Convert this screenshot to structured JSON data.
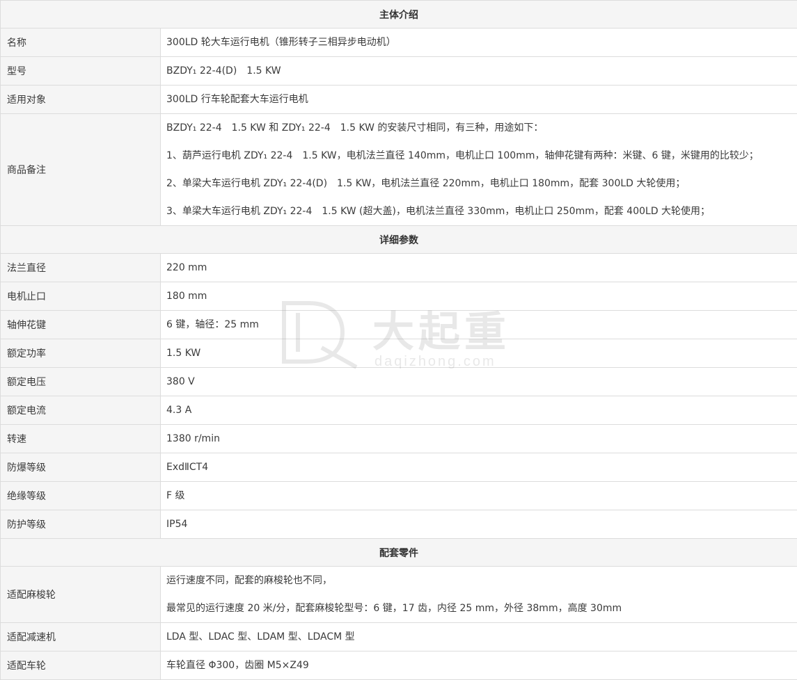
{
  "sections": [
    {
      "title": "主体介绍",
      "rows": [
        {
          "label": "名称",
          "lines": [
            "300LD 轮大车运行电机（锥形转子三相异步电动机）"
          ]
        },
        {
          "label": "型号",
          "lines": [
            "BZDY₁ 22-4(D)　1.5 KW"
          ]
        },
        {
          "label": "适用对象",
          "lines": [
            "300LD 行车轮配套大车运行电机"
          ]
        },
        {
          "label": "商品备注",
          "lines": [
            "BZDY₁ 22-4　1.5 KW 和 ZDY₁ 22-4　1.5 KW 的安装尺寸相同，有三种，用途如下：",
            "1、葫芦运行电机 ZDY₁ 22-4　1.5 KW，电机法兰直径 140mm，电机止口 100mm，轴伸花键有两种：米键、6 键，米键用的比较少；",
            "2、单梁大车运行电机 ZDY₁ 22-4(D)　1.5 KW，电机法兰直径 220mm，电机止口 180mm，配套 300LD 大轮使用；",
            "3、单梁大车运行电机 ZDY₁ 22-4　1.5 KW (超大盖)，电机法兰直径 330mm，电机止口 250mm，配套 400LD 大轮使用；"
          ]
        }
      ]
    },
    {
      "title": "详细参数",
      "rows": [
        {
          "label": "法兰直径",
          "lines": [
            "220 mm"
          ]
        },
        {
          "label": "电机止口",
          "lines": [
            "180 mm"
          ]
        },
        {
          "label": "轴伸花键",
          "lines": [
            "6 键，轴径：25 mm"
          ]
        },
        {
          "label": "额定功率",
          "lines": [
            "1.5 KW"
          ]
        },
        {
          "label": "额定电压",
          "lines": [
            "380 V"
          ]
        },
        {
          "label": "额定电流",
          "lines": [
            "4.3 A"
          ]
        },
        {
          "label": "转速",
          "lines": [
            "1380 r/min"
          ]
        },
        {
          "label": "防爆等级",
          "lines": [
            "ExdⅡCT4"
          ]
        },
        {
          "label": "绝缘等级",
          "lines": [
            "F 级"
          ]
        },
        {
          "label": "防护等级",
          "lines": [
            "IP54"
          ]
        }
      ]
    },
    {
      "title": "配套零件",
      "rows": [
        {
          "label": "适配麻梭轮",
          "lines": [
            "运行速度不同，配套的麻梭轮也不同，",
            "最常见的运行速度 20 米/分，配套麻梭轮型号：6 键，17 齿，内径 25 mm，外径 38mm，高度 30mm"
          ]
        },
        {
          "label": "适配减速机",
          "lines": [
            "LDA 型、LDAC 型、LDAM 型、LDACM 型"
          ]
        },
        {
          "label": "适配车轮",
          "lines": [
            "车轮直径 Φ300，齿圈 M5×Z49"
          ]
        }
      ]
    }
  ],
  "watermark": {
    "brand": "大起重",
    "url": "daqizhong.com",
    "color": "#9a9a9a"
  }
}
